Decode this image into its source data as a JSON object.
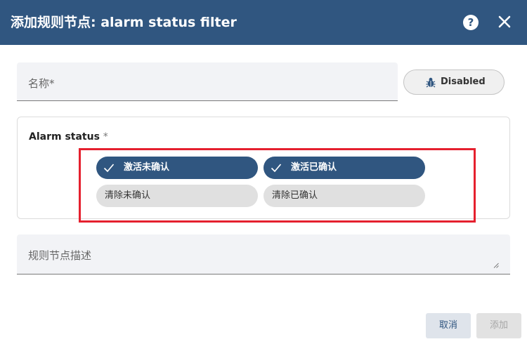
{
  "header": {
    "title": "添加规则节点: alarm status filter",
    "help_glyph": "?",
    "background": "#305680"
  },
  "name_field": {
    "placeholder": "名称*"
  },
  "debug_toggle": {
    "label": "Disabled",
    "icon": "bug-icon"
  },
  "alarm_status": {
    "label": "Alarm status",
    "required_mark": "*",
    "chips": [
      {
        "label": "激活未确认",
        "selected": true
      },
      {
        "label": "激活已确认",
        "selected": true
      },
      {
        "label": "清除未确认",
        "selected": false
      },
      {
        "label": "清除已确认",
        "selected": false
      }
    ],
    "highlight_color": "#e5202e"
  },
  "description_field": {
    "placeholder": "规则节点描述"
  },
  "footer": {
    "cancel_label": "取消",
    "add_label": "添加"
  }
}
